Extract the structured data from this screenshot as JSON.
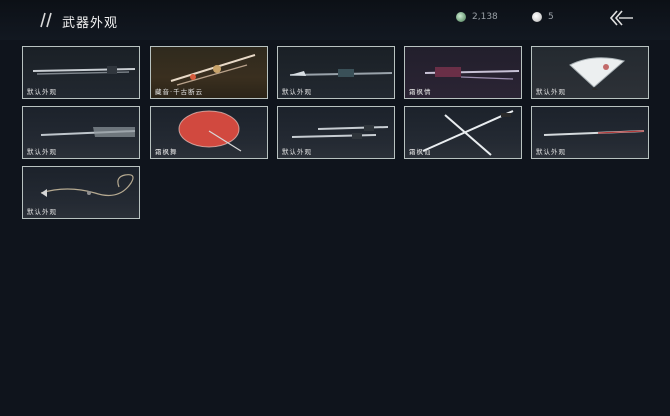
{
  "header": {
    "title": "武器外观",
    "currency_jade": "2,138",
    "currency_pearl": "5"
  },
  "items": [
    {
      "label": "默认外观",
      "icon": "long-sword-icon"
    },
    {
      "label": "藏音·千古断云",
      "icon": "ornate-staff-icon"
    },
    {
      "label": "默认外观",
      "icon": "spear-icon"
    },
    {
      "label": "霜枫情",
      "icon": "twin-blade-icon"
    },
    {
      "label": "默认外观",
      "icon": "fan-icon"
    },
    {
      "label": "默认外观",
      "icon": "feather-blade-icon"
    },
    {
      "label": "霜枫舞",
      "icon": "umbrella-icon"
    },
    {
      "label": "默认外观",
      "icon": "dual-knives-icon"
    },
    {
      "label": "霜枫仙",
      "icon": "crossed-katanas-icon"
    },
    {
      "label": "默认外观",
      "icon": "katana-icon"
    },
    {
      "label": "默认外观",
      "icon": "rope-dart-icon"
    }
  ]
}
